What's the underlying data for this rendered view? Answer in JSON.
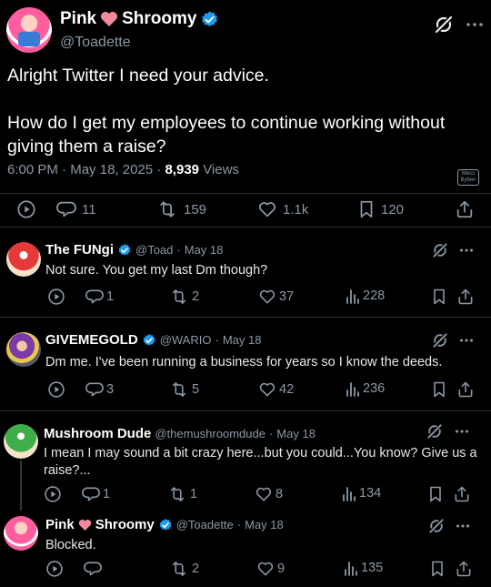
{
  "main": {
    "name_part1": "Pink",
    "name_part2": "Shroomy",
    "handle": "@Toadette",
    "text": "Alright Twitter I need your advice.\n\nHow do I get my employees to continue working without giving them a raise?",
    "time": "6:00 PM",
    "date": "May 18, 2025",
    "views_count": "8,939",
    "views_label": "Views",
    "stamp_text": "Mess Byben",
    "stats": {
      "replies": "11",
      "reposts": "159",
      "likes": "1.1k",
      "bookmarks": "120"
    }
  },
  "replies": [
    {
      "name": "The FUNgi",
      "handle": "@Toad",
      "date": "May 18",
      "text": "Not sure. You get my last Dm though?",
      "replies": "1",
      "reposts": "2",
      "likes": "37",
      "views": "228"
    },
    {
      "name": "GIVEMEGOLD",
      "handle": "@WARIO",
      "date": "May 18",
      "text": "Dm me. I've been running a business for years so I know the deeds.",
      "replies": "3",
      "reposts": "5",
      "likes": "42",
      "views": "236"
    },
    {
      "name": "Mushroom Dude",
      "handle": "@themushroomdude",
      "date": "May 18",
      "text": "I mean I may sound a bit crazy here...but you could...You know? Give us a raise?...",
      "replies": "1",
      "reposts": "1",
      "likes": "8",
      "views": "134"
    },
    {
      "name_part1": "Pink",
      "name_part2": "Shroomy",
      "handle": "@Toadette",
      "date": "May 18",
      "text": "Blocked.",
      "replies": "",
      "reposts": "2",
      "likes": "9",
      "views": "135"
    }
  ],
  "colors": {
    "verified": "#1d9bf0",
    "heart": "#f4899c",
    "background": "#000000",
    "muted": "#8b98a5"
  }
}
